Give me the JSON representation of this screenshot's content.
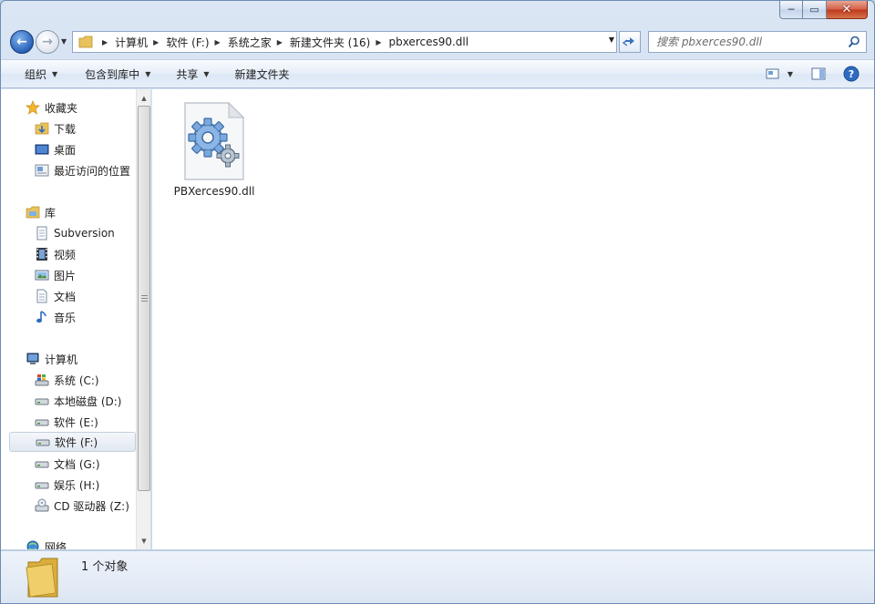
{
  "window": {
    "caption_min": "─",
    "caption_max": "▭",
    "caption_close": "✕"
  },
  "address": {
    "breadcrumbs": [
      "计算机",
      "软件 (F:)",
      "系统之家",
      "新建文件夹 (16)",
      "pbxerces90.dll"
    ],
    "search_placeholder": "搜索 pbxerces90.dll"
  },
  "toolbar": {
    "organize": "组织",
    "include_library": "包含到库中",
    "share": "共享",
    "new_folder": "新建文件夹"
  },
  "sidebar": {
    "favorites": "收藏夹",
    "favorites_items": [
      "下载",
      "桌面",
      "最近访问的位置"
    ],
    "libraries": "库",
    "libraries_items": [
      "Subversion",
      "视频",
      "图片",
      "文档",
      "音乐"
    ],
    "computer": "计算机",
    "computer_items": [
      "系统 (C:)",
      "本地磁盘 (D:)",
      "软件 (E:)",
      "软件 (F:)",
      "文档 (G:)",
      "娱乐 (H:)",
      "CD 驱动器 (Z:)"
    ],
    "network": "网络",
    "selected": "软件 (F:)"
  },
  "files": [
    {
      "name": "PBXerces90.dll",
      "icon": "dll-gear-icon"
    }
  ],
  "details": {
    "count_text": "1 个对象"
  },
  "colors": {
    "accent": "#3a73c4",
    "close": "#c1391b",
    "folder": "#e8c25a"
  }
}
